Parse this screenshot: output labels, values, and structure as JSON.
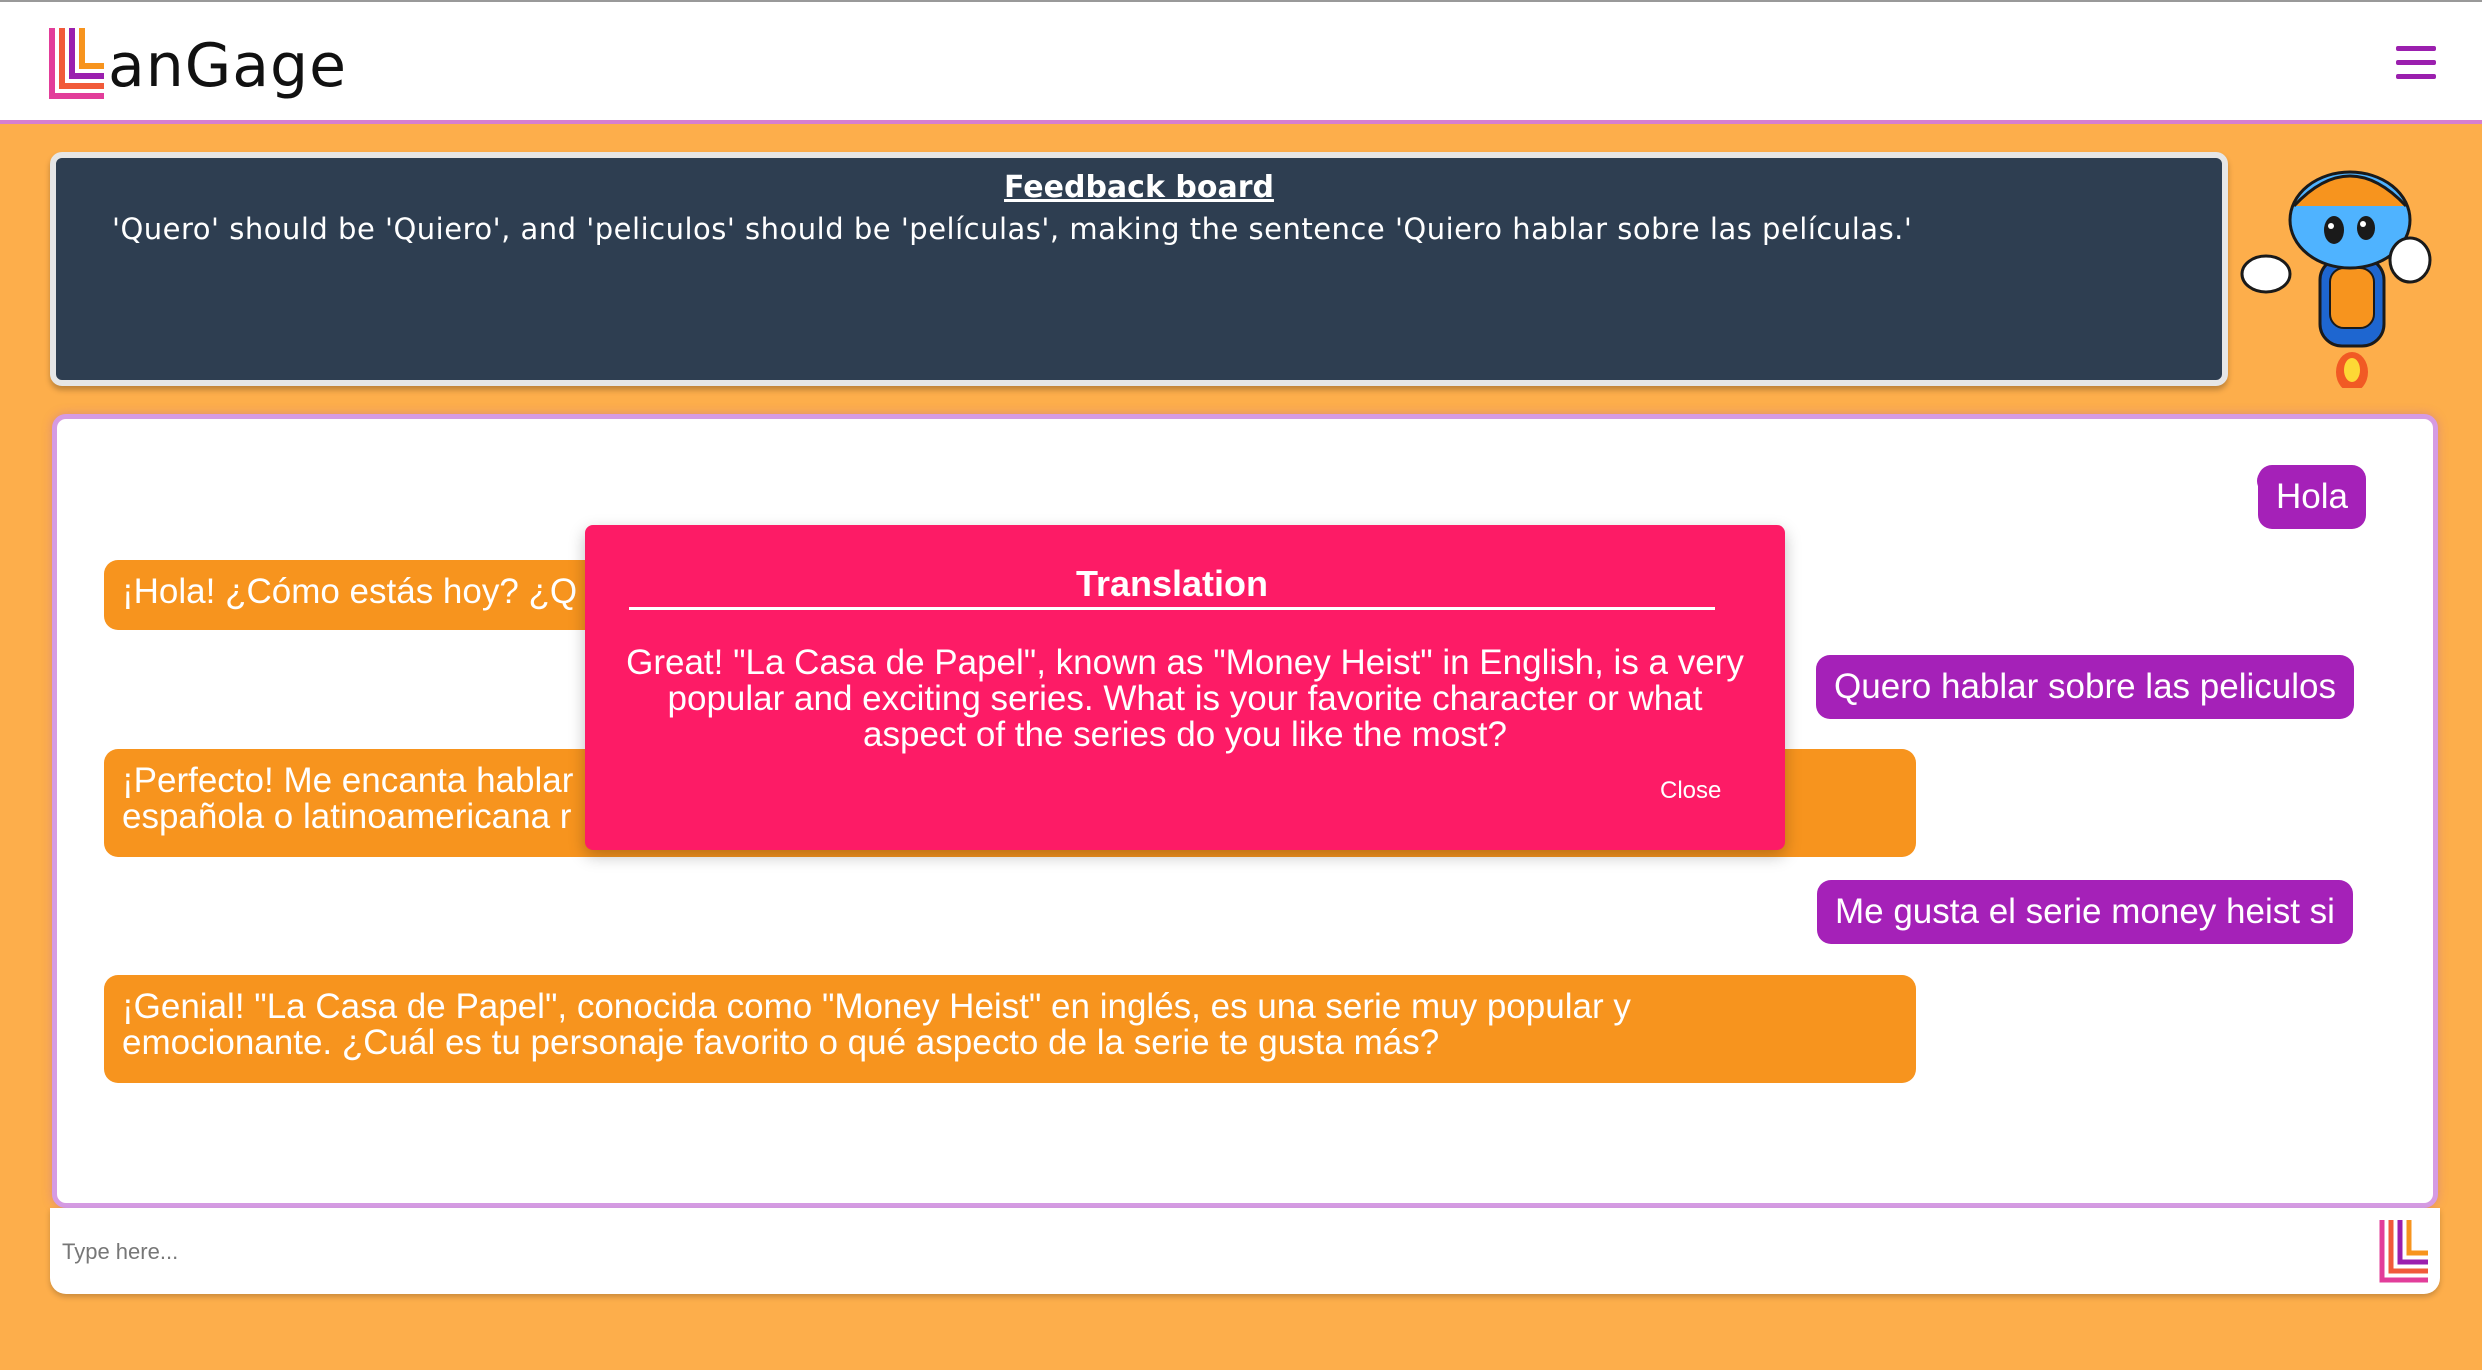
{
  "header": {
    "brand": "anGage",
    "logo_icon": "langage-logo-icon",
    "menu_icon": "hamburger-menu-icon"
  },
  "feedback": {
    "title": "Feedback board",
    "text": "'Quero' should be 'Quiero', and 'peliculos' should be 'películas', making the sentence 'Quiero hablar sobre las películas.'"
  },
  "mascot": "robot-mascot-icon",
  "chat": {
    "messages": [
      {
        "role": "user",
        "text": "Hola"
      },
      {
        "role": "bot",
        "text": "¡Hola! ¿Cómo estás hoy? ¿Q"
      },
      {
        "role": "user",
        "text": "Quero hablar sobre las peliculos"
      },
      {
        "role": "bot",
        "text": "¡Perfecto! Me encanta hablar",
        "text2": "española o latinoamericana r"
      },
      {
        "role": "user",
        "text": "Me gusta el serie money heist si"
      },
      {
        "role": "bot",
        "text": "¡Genial! \"La Casa de Papel\", conocida como \"Money Heist\" en inglés, es una serie muy popular y",
        "text2": "emocionante. ¿Cuál es tu personaje favorito o qué aspecto de la serie te gusta más?"
      }
    ]
  },
  "input": {
    "placeholder": "Type here...",
    "send_icon": "langage-logo-send-icon"
  },
  "modal": {
    "title": "Translation",
    "body": "Great! \"La Casa de Papel\", known as \"Money Heist\" in English, is a very popular and exciting series. What is your favorite character or what aspect of the series do you like the most?",
    "close_label": "Close"
  },
  "colors": {
    "background": "#fdae4b",
    "user_bubble": "#a521b8",
    "bot_bubble": "#f7941e",
    "modal": "#fd1b66",
    "feedback_board": "#2e3e51"
  }
}
